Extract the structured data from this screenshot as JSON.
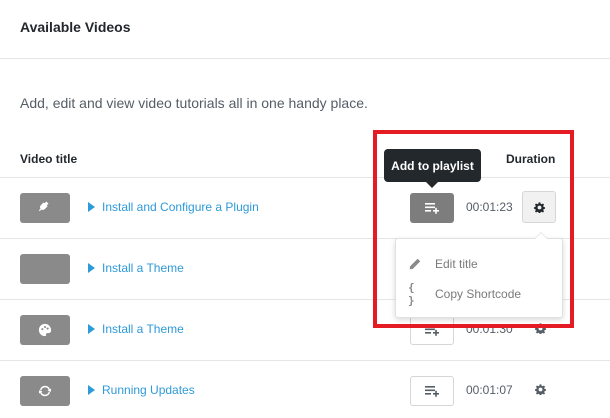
{
  "panel": {
    "title": "Available Videos"
  },
  "intro": "Add, edit and view video tutorials all in one handy place.",
  "columns": {
    "title": "Video title",
    "duration": "Duration"
  },
  "tooltip": "Add to playlist",
  "videos": [
    {
      "title": "Install and Configure a Plugin",
      "duration": "00:01:23",
      "thumb_icon": "plug-icon"
    },
    {
      "title": "Install a Theme",
      "duration": "",
      "thumb_icon": ""
    },
    {
      "title": "Install a Theme",
      "duration": "00:01:30",
      "thumb_icon": "palette-icon"
    },
    {
      "title": "Running Updates",
      "duration": "00:01:07",
      "thumb_icon": "refresh-icon"
    }
  ],
  "menu": {
    "edit_title": "Edit title",
    "copy_shortcode": "Copy Shortcode",
    "copy_icon_glyph": "{ }"
  },
  "colors": {
    "link": "#2e9ad8",
    "highlight": "#e41b23",
    "thumb": "#8a8a8a",
    "tooltip_bg": "#23282d"
  }
}
